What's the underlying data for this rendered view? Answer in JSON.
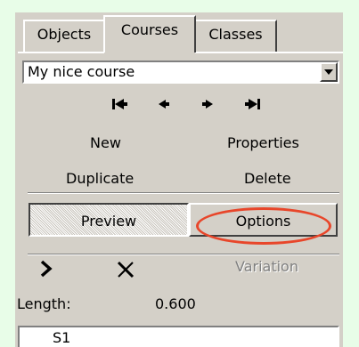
{
  "tabs": [
    {
      "label": "Objects",
      "active": false
    },
    {
      "label": "Courses",
      "active": true
    },
    {
      "label": "Classes",
      "active": false
    }
  ],
  "course_select": {
    "value": "My nice course"
  },
  "nav": {
    "icons": [
      "first-icon",
      "previous-icon",
      "next-icon",
      "last-icon"
    ]
  },
  "commands": {
    "new": "New",
    "properties": "Properties",
    "duplicate": "Duplicate",
    "delete": "Delete"
  },
  "mode": {
    "preview": "Preview",
    "options": "Options",
    "selected": "Preview",
    "highlight_color": "#e8462a"
  },
  "tools": {
    "variation": "Variation",
    "variation_enabled": false
  },
  "length": {
    "label": "Length:",
    "value": "0.600"
  },
  "controls": [
    "S1"
  ],
  "colors": {
    "background": "#e8fde8",
    "panel": "#d4d0c8"
  }
}
